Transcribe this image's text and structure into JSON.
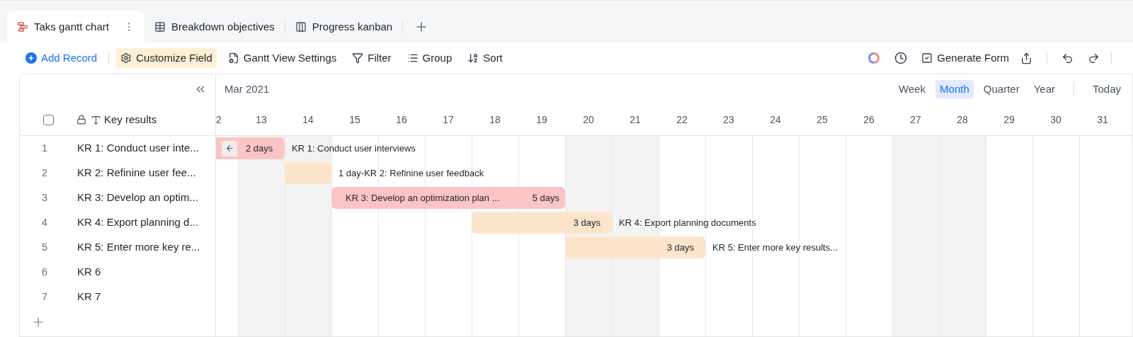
{
  "tabs": [
    {
      "label": "Taks gantt chart",
      "kind": "gantt",
      "selected": true
    },
    {
      "label": "Breakdown objectives",
      "kind": "table",
      "selected": false
    },
    {
      "label": "Progress kanban",
      "kind": "kanban",
      "selected": false
    }
  ],
  "toolbar": {
    "left": [
      {
        "label": "Add Record",
        "kind": "add",
        "selected": false
      },
      {
        "label": "Customize Field",
        "kind": "gear",
        "selected": true
      },
      {
        "label": "Gantt View Settings",
        "kind": "settings",
        "selected": false
      },
      {
        "label": "Filter",
        "kind": "filter",
        "selected": false
      },
      {
        "label": "Group",
        "kind": "group",
        "selected": false
      },
      {
        "label": "Sort",
        "kind": "sort",
        "selected": false
      }
    ],
    "right": [
      {
        "label": "Generate Form"
      }
    ]
  },
  "timeline": {
    "month": "Mar 2021",
    "scales": [
      {
        "label": "Week",
        "selected": false
      },
      {
        "label": "Month",
        "selected": true
      },
      {
        "label": "Quarter",
        "selected": false
      },
      {
        "label": "Year",
        "selected": false
      }
    ],
    "today": "Today",
    "days": [
      {
        "label": "2",
        "weekend": false
      },
      {
        "label": "13",
        "weekend": true
      },
      {
        "label": "14",
        "weekend": true
      },
      {
        "label": "15",
        "weekend": false
      },
      {
        "label": "16",
        "weekend": false
      },
      {
        "label": "17",
        "weekend": false
      },
      {
        "label": "18",
        "weekend": false
      },
      {
        "label": "19",
        "weekend": false
      },
      {
        "label": "20",
        "weekend": true
      },
      {
        "label": "21",
        "weekend": true
      },
      {
        "label": "22",
        "weekend": false
      },
      {
        "label": "23",
        "weekend": false
      },
      {
        "label": "24",
        "weekend": false
      },
      {
        "label": "25",
        "weekend": false
      },
      {
        "label": "26",
        "weekend": false
      },
      {
        "label": "27",
        "weekend": true
      },
      {
        "label": "28",
        "weekend": true
      },
      {
        "label": "29",
        "weekend": false
      },
      {
        "label": "30",
        "weekend": false
      },
      {
        "label": "31",
        "weekend": false
      }
    ]
  },
  "table": {
    "column": "Key results",
    "checked": false,
    "rows": [
      {
        "number": "1",
        "title": "KR 1: Conduct user inte...",
        "bar": {
          "color": "#fcc5c5",
          "arrow": true,
          "inner": [
            "2 days"
          ],
          "outer": "KR 1: Conduct user interviews",
          "filled": [
            true,
            true,
            false,
            false,
            false,
            false,
            false,
            false,
            false,
            false,
            false,
            false,
            false,
            false,
            false,
            false,
            false,
            false,
            false,
            false
          ]
        }
      },
      {
        "number": "2",
        "title": "KR 2: Refinine user fee...",
        "bar": {
          "color": "#fde5cc",
          "arrow": false,
          "outer": "1 day-KR 2: Refinine user feedback",
          "filled": [
            false,
            false,
            true,
            false,
            false,
            false,
            false,
            false,
            false,
            false,
            false,
            false,
            false,
            false,
            false,
            false,
            false,
            false,
            false,
            false
          ]
        }
      },
      {
        "number": "3",
        "title": "KR 3: Develop an optim...",
        "bar": {
          "color": "#fcc5c5",
          "arrow": false,
          "inner": [
            "KR 3: Develop an optimization plan ...",
            "5 days"
          ],
          "filled": [
            false,
            false,
            false,
            true,
            true,
            true,
            true,
            true,
            false,
            false,
            false,
            false,
            false,
            false,
            false,
            false,
            false,
            false,
            false,
            false
          ]
        }
      },
      {
        "number": "4",
        "title": "KR 4: Export planning d...",
        "bar": {
          "color": "#fde5cc",
          "arrow": false,
          "inner": [
            "3 days"
          ],
          "outer": "KR 4: Export planning documents",
          "filled": [
            false,
            false,
            false,
            false,
            false,
            false,
            true,
            true,
            true,
            false,
            false,
            false,
            false,
            false,
            false,
            false,
            false,
            false,
            false,
            false
          ]
        }
      },
      {
        "number": "5",
        "title": "KR 5: Enter more key re...",
        "bar": {
          "color": "#fde5cc",
          "arrow": false,
          "inner": [
            "3 days"
          ],
          "outer": "KR 5: Enter more key results...",
          "filled": [
            false,
            false,
            false,
            false,
            false,
            false,
            false,
            false,
            true,
            true,
            true,
            false,
            false,
            false,
            false,
            false,
            false,
            false,
            false,
            false
          ]
        }
      },
      {
        "number": "6",
        "title": "KR 6"
      },
      {
        "number": "7",
        "title": "KR 7"
      }
    ]
  }
}
